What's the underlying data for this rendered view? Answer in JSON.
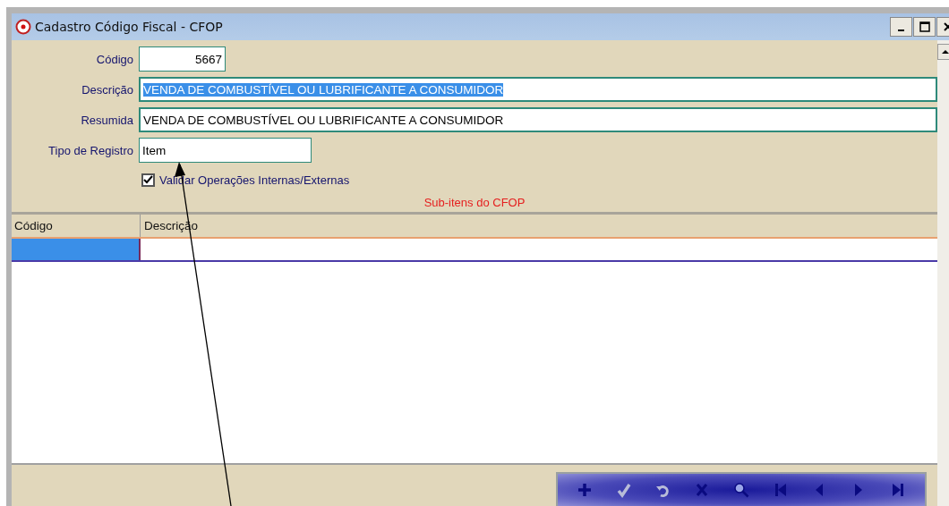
{
  "window": {
    "title": "Cadastro Código Fiscal - CFOP"
  },
  "fields": [
    {
      "label": "Código",
      "value": "5667",
      "kind": "number",
      "highlighted": false
    },
    {
      "label": "Descrição",
      "value": "VENDA DE COMBUSTÍVEL OU LUBRIFICANTE A CONSUMIDOR",
      "kind": "text",
      "highlighted": true
    },
    {
      "label": "Resumida",
      "value": "VENDA DE COMBUSTÍVEL OU LUBRIFICANTE A CONSUMIDOR",
      "kind": "text",
      "highlighted": false
    },
    {
      "label": "Tipo de Registro",
      "value": "Item",
      "kind": "choice",
      "highlighted": false
    }
  ],
  "checkbox": {
    "label": "Validar Operações Internas/Externas",
    "checked": true
  },
  "section_title": "Sub-itens do CFOP",
  "grid": {
    "columns": [
      "Código",
      "Descrição"
    ]
  },
  "toolbar": [
    {
      "kind": "add",
      "disabled": false
    },
    {
      "kind": "confirm",
      "disabled": true
    },
    {
      "kind": "undo",
      "disabled": true
    },
    {
      "kind": "delete",
      "disabled": false
    },
    {
      "kind": "search",
      "disabled": false
    },
    {
      "kind": "first",
      "disabled": false
    },
    {
      "kind": "prev",
      "disabled": false
    },
    {
      "kind": "next",
      "disabled": false
    },
    {
      "kind": "last",
      "disabled": false
    }
  ]
}
